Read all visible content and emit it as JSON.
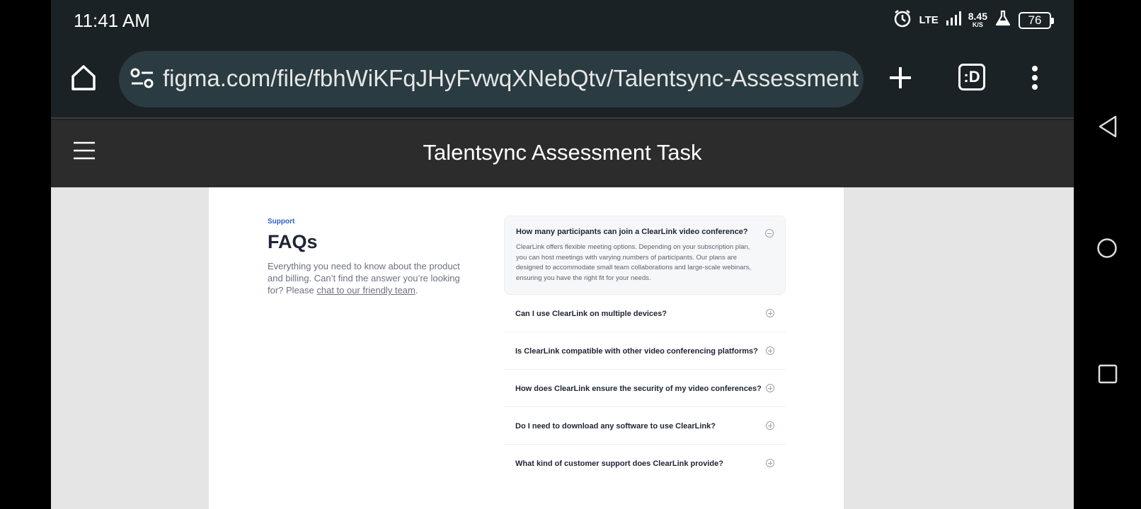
{
  "status_bar": {
    "time": "11:41 AM",
    "network": "LTE",
    "speed_value": "8.45",
    "speed_unit": "K/S",
    "battery": "76"
  },
  "browser": {
    "url": "figma.com/file/fbhWiKFqJHyFvwqXNebQtv/Talentsync-Assessment",
    "tab_switcher": ":D"
  },
  "figma": {
    "title": "Talentsync Assessment Task"
  },
  "faq_page": {
    "eyebrow": "Support",
    "heading": "FAQs",
    "description": "Everything you need to know about the product and billing. Can’t find the answer you’re looking for? Please ",
    "link_text": "chat to our friendly team",
    "description_end": ".",
    "items": [
      {
        "question": "How many participants can join a ClearLink video conference?",
        "answer": "ClearLink offers flexible meeting options. Depending on your subscription plan, you can host meetings with varying numbers of participants. Our plans are designed to accommodate small team collaborations and large-scale webinars, ensuring you have the right fit for your needs.",
        "expanded": true
      },
      {
        "question": "Can I use ClearLink on multiple devices?",
        "expanded": false
      },
      {
        "question": "Is ClearLink compatible with other video conferencing platforms?",
        "expanded": false
      },
      {
        "question": "How does ClearLink ensure the security of my video conferences?",
        "expanded": false
      },
      {
        "question": "Do I need to download any software to use ClearLink?",
        "expanded": false
      },
      {
        "question": "What kind of customer support does ClearLink provide?",
        "expanded": false
      }
    ]
  },
  "colors": {
    "accent": "#2f5fc4",
    "heading": "#1d2433",
    "toolbar": "#1b2226",
    "figma_header": "#2c2c2c"
  }
}
